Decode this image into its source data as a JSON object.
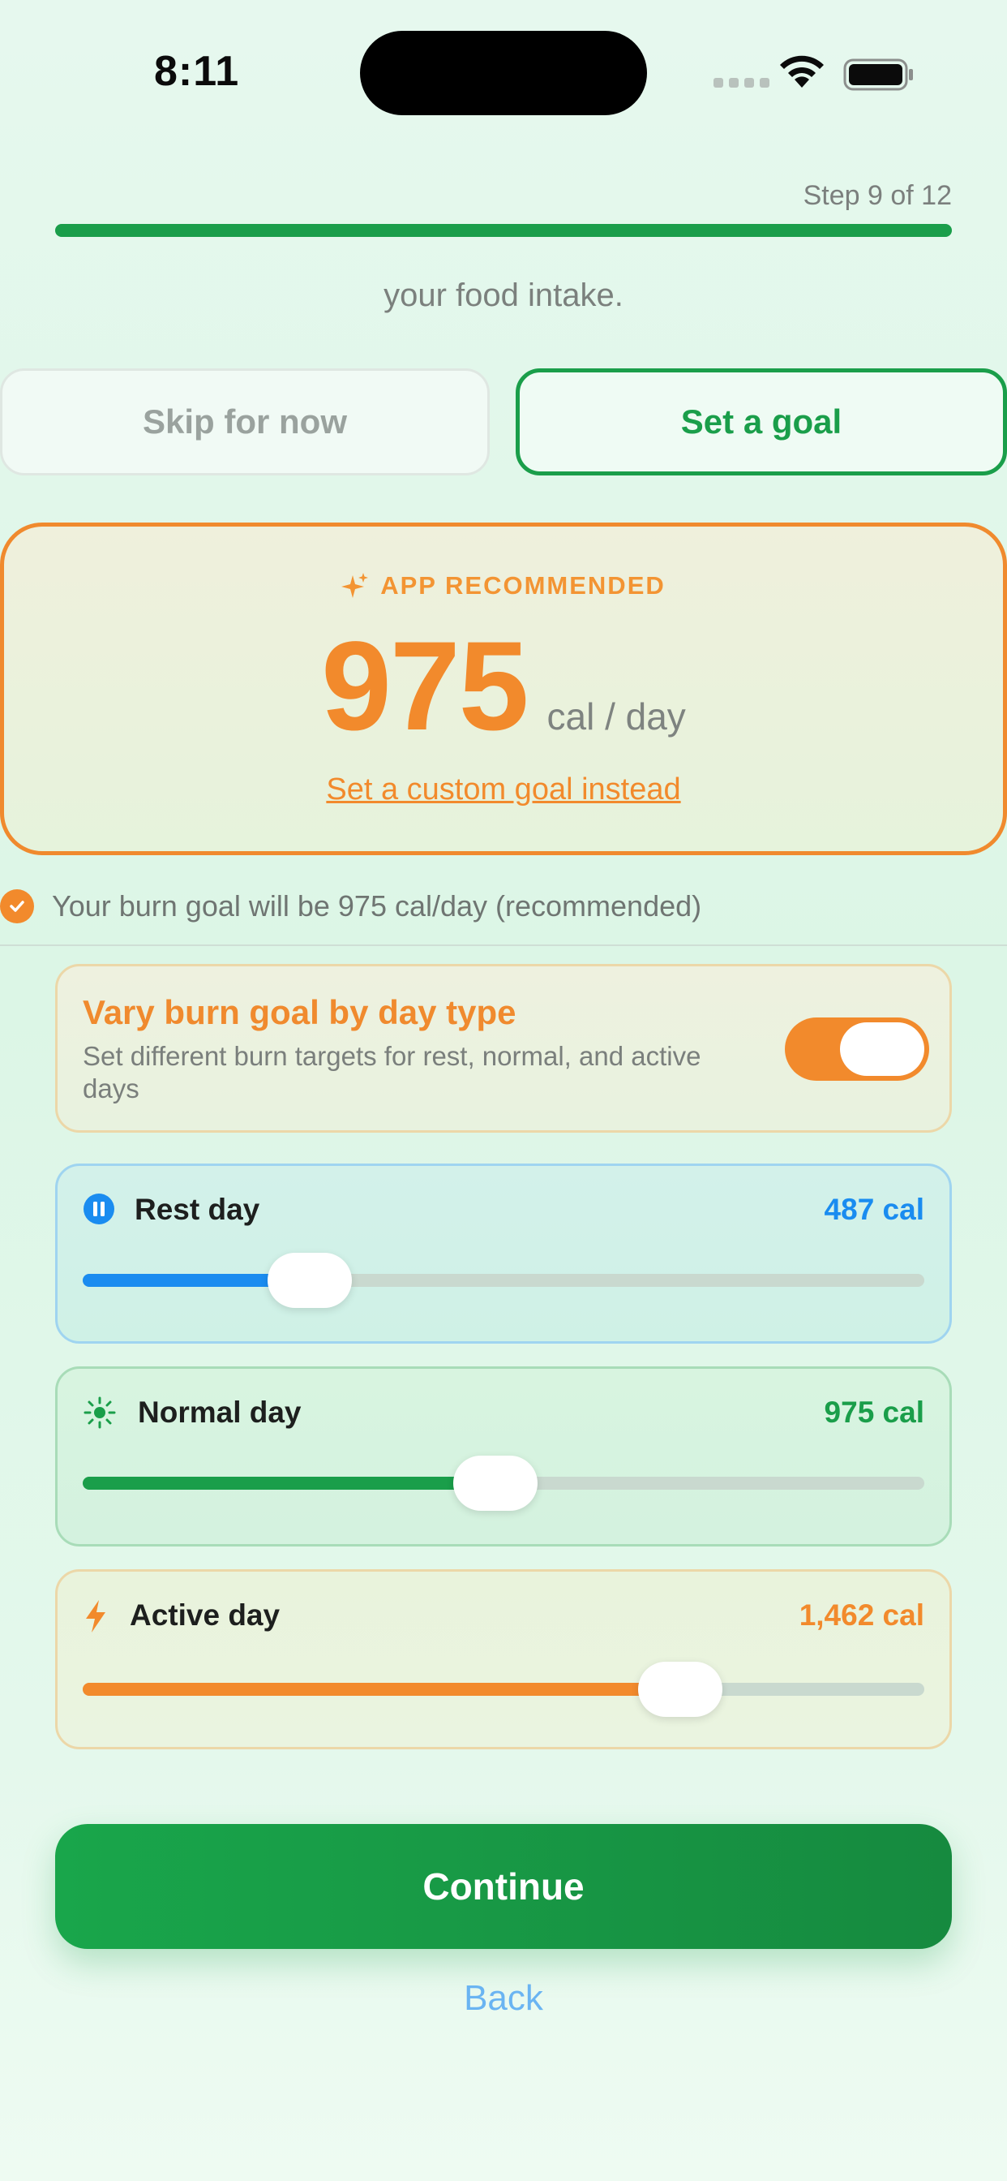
{
  "status": {
    "time": "8:11"
  },
  "progress": {
    "step_text": "Step 9 of 12",
    "fraction": 1.0
  },
  "intro": {
    "clipped_text": "your food intake."
  },
  "actions": {
    "skip_label": "Skip for now",
    "goal_label": "Set a goal"
  },
  "recommended": {
    "label": "APP RECOMMENDED",
    "value": "975",
    "unit": "cal / day",
    "custom_link": "Set a custom goal instead",
    "accent": "#f28a2c"
  },
  "burn_note": "Your burn goal will be 975 cal/day (recommended)",
  "vary": {
    "title": "Vary burn goal by day type",
    "description": "Set different burn targets for rest, normal, and active days",
    "enabled": true
  },
  "days": [
    {
      "label": "Rest day",
      "value": "487 cal",
      "level": 0.27,
      "icon": "pause-icon",
      "color": "#1a8cf0"
    },
    {
      "label": "Normal day",
      "value": "975 cal",
      "level": 0.49,
      "icon": "sun-icon",
      "color": "#1a9e4a"
    },
    {
      "label": "Active day",
      "value": "1,462 cal",
      "level": 0.71,
      "icon": "bolt-icon",
      "color": "#f28a2c"
    }
  ],
  "footer": {
    "continue_label": "Continue",
    "back_label": "Back"
  }
}
